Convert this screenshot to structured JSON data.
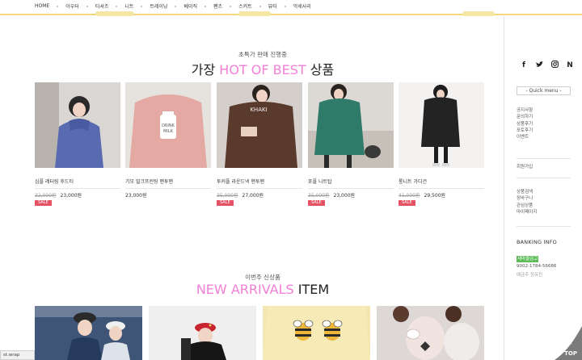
{
  "nav": {
    "items": [
      "HOME",
      "아우터",
      "티셔츠",
      "니트",
      "트레이닝",
      "베이직",
      "팬츠",
      "스커트",
      "뷰티",
      "악세사리"
    ]
  },
  "sidebar": {
    "quick_menu": "- Quick menu -",
    "links_group1": [
      "공지사항",
      "문의하기",
      "상품후기",
      "포토후기",
      "이벤트"
    ],
    "links_group2": [
      "회원가입"
    ],
    "links_group3": [
      "상품검색",
      "장바구니",
      "관심상품",
      "마이페이지"
    ],
    "banking_title": "BANKING INFO",
    "bank_name": "새마을금고",
    "bank_account": "9002-1784-56686",
    "bank_holder": "예금주 정유진",
    "social_icons": [
      "facebook-icon",
      "twitter-icon",
      "instagram-icon",
      "naver-icon"
    ]
  },
  "best": {
    "subtitle": "초특가 판매 진행중",
    "title_left": "가장 ",
    "title_pink": "HOT OF BEST",
    "title_right": " 상품",
    "products": [
      {
        "name": "심플 레터링 후드티",
        "old_price": "32,000원",
        "price": "23,000원",
        "badge": "SALE",
        "color": "#5a6ab0"
      },
      {
        "name": "기모 밀크프린팅 맨투맨",
        "old_price": "",
        "price": "23,000원",
        "badge": "",
        "color": "#e3a9a2"
      },
      {
        "name": "투커플 라운드넥 맨투맨",
        "old_price": "35,000원",
        "price": "27,000원",
        "badge": "SALE",
        "color": "#5a3a2c"
      },
      {
        "name": "포플 니트탑",
        "old_price": "35,000원",
        "price": "23,000원",
        "badge": "SALE",
        "color": "#2f7a68"
      },
      {
        "name": "롱니트 가디건",
        "old_price": "41,000원",
        "price": "29,500원",
        "badge": "SALE",
        "color": "#232323"
      }
    ]
  },
  "arrivals": {
    "subtitle": "이번주 신상품",
    "title_pink": "NEW ARRIVALS",
    "title_right": " ITEM"
  },
  "status_bar": "st.wrap",
  "top_button": "TOP"
}
